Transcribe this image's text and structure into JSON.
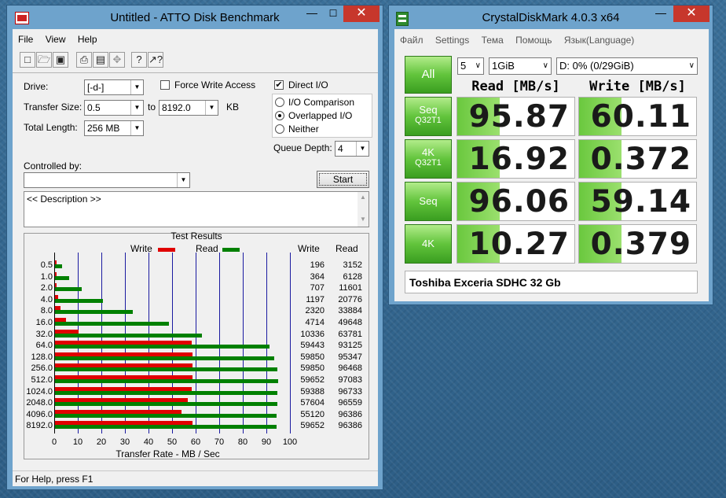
{
  "atto": {
    "title": "Untitled - ATTO Disk Benchmark",
    "menu": [
      "File",
      "View",
      "Help"
    ],
    "toolbar_icons": [
      "new-icon",
      "open-icon",
      "save-icon",
      "print-icon",
      "print-preview-icon",
      "move-icon",
      "help-icon",
      "context-help-icon"
    ],
    "drive_label": "Drive:",
    "drive_value": "[-d-]",
    "force_write_label": "Force Write Access",
    "direct_io_label": "Direct I/O",
    "direct_io_checked": true,
    "transfer_size_label": "Transfer Size:",
    "transfer_from": "0.5",
    "to_label": "to",
    "transfer_to": "8192.0",
    "kb_label": "KB",
    "total_length_label": "Total Length:",
    "total_length_value": "256 MB",
    "io_comparison_label": "I/O Comparison",
    "overlapped_io_label": "Overlapped I/O",
    "neither_label": "Neither",
    "queue_depth_label": "Queue Depth:",
    "queue_depth_value": "4",
    "controlled_by_label": "Controlled by:",
    "controlled_by_value": "",
    "start_label": "Start",
    "description_text": "<< Description >>",
    "results_title": "Test Results",
    "legend_write": "Write",
    "legend_read": "Read",
    "col_write": "Write",
    "col_read": "Read",
    "xlabel": "Transfer Rate - MB / Sec",
    "status": "For Help, press F1",
    "colors": {
      "write": "#e00000",
      "read": "#008000"
    }
  },
  "chart_data": {
    "type": "bar",
    "title": "Test Results",
    "xlabel": "Transfer Rate - MB / Sec",
    "xlim": [
      0,
      100
    ],
    "xticks": [
      "0",
      "10",
      "20",
      "30",
      "40",
      "50",
      "60",
      "70",
      "80",
      "90",
      "100"
    ],
    "categories": [
      "0.5",
      "1.0",
      "2.0",
      "4.0",
      "8.0",
      "16.0",
      "32.0",
      "64.0",
      "128.0",
      "256.0",
      "512.0",
      "1024.0",
      "2048.0",
      "4096.0",
      "8192.0"
    ],
    "series": [
      {
        "name": "Write",
        "values": [
          196,
          364,
          707,
          1197,
          2320,
          4714,
          10336,
          59443,
          59850,
          59850,
          59652,
          59388,
          57604,
          55120,
          59652
        ]
      },
      {
        "name": "Read",
        "values": [
          3152,
          6128,
          11601,
          20776,
          33884,
          49648,
          63781,
          93125,
          95347,
          96468,
          97083,
          96733,
          96559,
          96386,
          96386
        ]
      }
    ]
  },
  "cdm": {
    "title": "CrystalDiskMark 4.0.3 x64",
    "menu": [
      "Файл",
      "Settings",
      "Тема",
      "Помощь",
      "Язык(Language)"
    ],
    "all_label": "All",
    "count_value": "5",
    "size_value": "1GiB",
    "drive_value": "D: 0% (0/29GiB)",
    "read_header": "Read [MB/s]",
    "write_header": "Write [MB/s]",
    "rows": [
      {
        "label1": "Seq",
        "label2": "Q32T1",
        "read": "95.87",
        "write": "60.11"
      },
      {
        "label1": "4K",
        "label2": "Q32T1",
        "read": "16.92",
        "write": "0.372"
      },
      {
        "label1": "Seq",
        "label2": "",
        "read": "96.06",
        "write": "59.14"
      },
      {
        "label1": "4K",
        "label2": "",
        "read": "10.27",
        "write": "0.379"
      }
    ],
    "comment": "Toshiba Exceria SDHC 32 Gb"
  }
}
